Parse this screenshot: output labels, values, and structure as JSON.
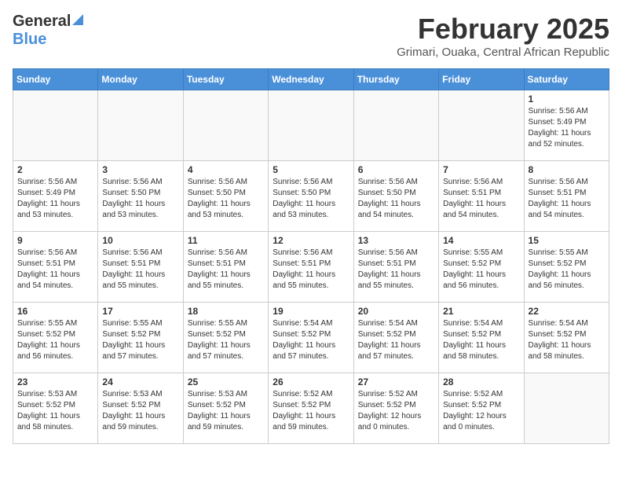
{
  "header": {
    "logo_general": "General",
    "logo_blue": "Blue",
    "month_year": "February 2025",
    "location": "Grimari, Ouaka, Central African Republic"
  },
  "calendar": {
    "days_of_week": [
      "Sunday",
      "Monday",
      "Tuesday",
      "Wednesday",
      "Thursday",
      "Friday",
      "Saturday"
    ],
    "weeks": [
      [
        {
          "day": "",
          "info": ""
        },
        {
          "day": "",
          "info": ""
        },
        {
          "day": "",
          "info": ""
        },
        {
          "day": "",
          "info": ""
        },
        {
          "day": "",
          "info": ""
        },
        {
          "day": "",
          "info": ""
        },
        {
          "day": "1",
          "info": "Sunrise: 5:56 AM\nSunset: 5:49 PM\nDaylight: 11 hours\nand 52 minutes."
        }
      ],
      [
        {
          "day": "2",
          "info": "Sunrise: 5:56 AM\nSunset: 5:49 PM\nDaylight: 11 hours\nand 53 minutes."
        },
        {
          "day": "3",
          "info": "Sunrise: 5:56 AM\nSunset: 5:50 PM\nDaylight: 11 hours\nand 53 minutes."
        },
        {
          "day": "4",
          "info": "Sunrise: 5:56 AM\nSunset: 5:50 PM\nDaylight: 11 hours\nand 53 minutes."
        },
        {
          "day": "5",
          "info": "Sunrise: 5:56 AM\nSunset: 5:50 PM\nDaylight: 11 hours\nand 53 minutes."
        },
        {
          "day": "6",
          "info": "Sunrise: 5:56 AM\nSunset: 5:50 PM\nDaylight: 11 hours\nand 54 minutes."
        },
        {
          "day": "7",
          "info": "Sunrise: 5:56 AM\nSunset: 5:51 PM\nDaylight: 11 hours\nand 54 minutes."
        },
        {
          "day": "8",
          "info": "Sunrise: 5:56 AM\nSunset: 5:51 PM\nDaylight: 11 hours\nand 54 minutes."
        }
      ],
      [
        {
          "day": "9",
          "info": "Sunrise: 5:56 AM\nSunset: 5:51 PM\nDaylight: 11 hours\nand 54 minutes."
        },
        {
          "day": "10",
          "info": "Sunrise: 5:56 AM\nSunset: 5:51 PM\nDaylight: 11 hours\nand 55 minutes."
        },
        {
          "day": "11",
          "info": "Sunrise: 5:56 AM\nSunset: 5:51 PM\nDaylight: 11 hours\nand 55 minutes."
        },
        {
          "day": "12",
          "info": "Sunrise: 5:56 AM\nSunset: 5:51 PM\nDaylight: 11 hours\nand 55 minutes."
        },
        {
          "day": "13",
          "info": "Sunrise: 5:56 AM\nSunset: 5:51 PM\nDaylight: 11 hours\nand 55 minutes."
        },
        {
          "day": "14",
          "info": "Sunrise: 5:55 AM\nSunset: 5:52 PM\nDaylight: 11 hours\nand 56 minutes."
        },
        {
          "day": "15",
          "info": "Sunrise: 5:55 AM\nSunset: 5:52 PM\nDaylight: 11 hours\nand 56 minutes."
        }
      ],
      [
        {
          "day": "16",
          "info": "Sunrise: 5:55 AM\nSunset: 5:52 PM\nDaylight: 11 hours\nand 56 minutes."
        },
        {
          "day": "17",
          "info": "Sunrise: 5:55 AM\nSunset: 5:52 PM\nDaylight: 11 hours\nand 57 minutes."
        },
        {
          "day": "18",
          "info": "Sunrise: 5:55 AM\nSunset: 5:52 PM\nDaylight: 11 hours\nand 57 minutes."
        },
        {
          "day": "19",
          "info": "Sunrise: 5:54 AM\nSunset: 5:52 PM\nDaylight: 11 hours\nand 57 minutes."
        },
        {
          "day": "20",
          "info": "Sunrise: 5:54 AM\nSunset: 5:52 PM\nDaylight: 11 hours\nand 57 minutes."
        },
        {
          "day": "21",
          "info": "Sunrise: 5:54 AM\nSunset: 5:52 PM\nDaylight: 11 hours\nand 58 minutes."
        },
        {
          "day": "22",
          "info": "Sunrise: 5:54 AM\nSunset: 5:52 PM\nDaylight: 11 hours\nand 58 minutes."
        }
      ],
      [
        {
          "day": "23",
          "info": "Sunrise: 5:53 AM\nSunset: 5:52 PM\nDaylight: 11 hours\nand 58 minutes."
        },
        {
          "day": "24",
          "info": "Sunrise: 5:53 AM\nSunset: 5:52 PM\nDaylight: 11 hours\nand 59 minutes."
        },
        {
          "day": "25",
          "info": "Sunrise: 5:53 AM\nSunset: 5:52 PM\nDaylight: 11 hours\nand 59 minutes."
        },
        {
          "day": "26",
          "info": "Sunrise: 5:52 AM\nSunset: 5:52 PM\nDaylight: 11 hours\nand 59 minutes."
        },
        {
          "day": "27",
          "info": "Sunrise: 5:52 AM\nSunset: 5:52 PM\nDaylight: 12 hours\nand 0 minutes."
        },
        {
          "day": "28",
          "info": "Sunrise: 5:52 AM\nSunset: 5:52 PM\nDaylight: 12 hours\nand 0 minutes."
        },
        {
          "day": "",
          "info": ""
        }
      ]
    ]
  }
}
